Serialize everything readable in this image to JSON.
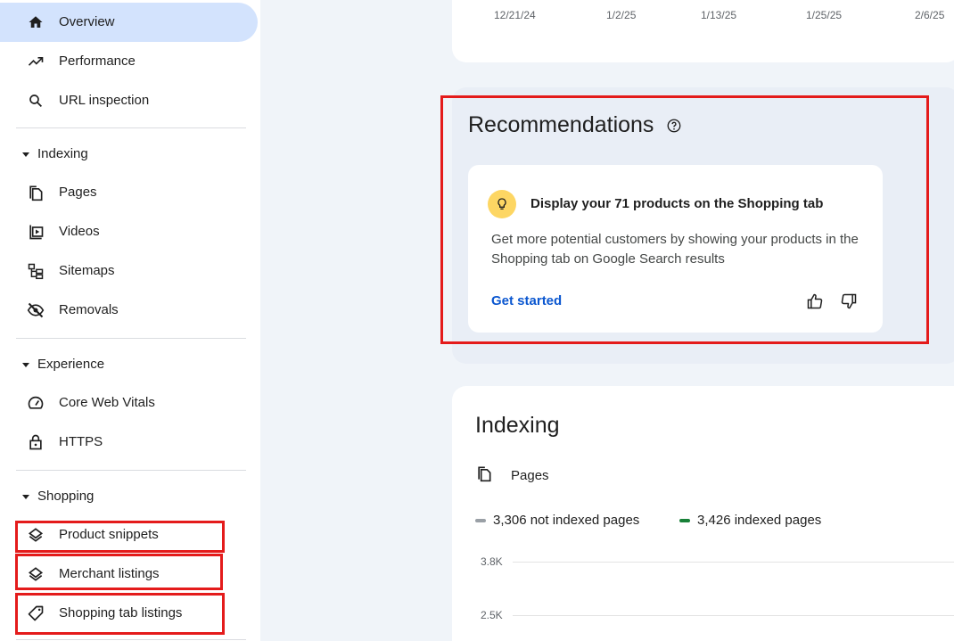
{
  "sidebar": {
    "overview": "Overview",
    "performance": "Performance",
    "url_inspection": "URL inspection",
    "indexing_section": "Indexing",
    "pages": "Pages",
    "videos": "Videos",
    "sitemaps": "Sitemaps",
    "removals": "Removals",
    "experience_section": "Experience",
    "core_web_vitals": "Core Web Vitals",
    "https": "HTTPS",
    "shopping_section": "Shopping",
    "product_snippets": "Product snippets",
    "merchant_listings": "Merchant listings",
    "shopping_tab_listings": "Shopping tab listings"
  },
  "top_chart": {
    "x_ticks": [
      "12/21/24",
      "1/2/25",
      "1/13/25",
      "1/25/25",
      "2/6/25"
    ]
  },
  "recommendations": {
    "title": "Recommendations",
    "card_title": "Display your 71 products on the Shopping tab",
    "card_body": "Get more potential customers by showing your products in the Shopping tab on Google Search results",
    "action": "Get started"
  },
  "indexing": {
    "title": "Indexing",
    "subtitle": "Pages",
    "legend_not_indexed": "3,306 not indexed pages",
    "legend_indexed": "3,426 indexed pages",
    "y_ticks": [
      "3.8K",
      "2.5K"
    ]
  },
  "colors": {
    "accent_blue": "#0b57d0",
    "active_nav_bg": "#d3e3fd",
    "highlight_red": "#e41b1b",
    "not_indexed_gray": "#9aa0a6",
    "indexed_green": "#188038",
    "bulb_yellow": "#fdd663"
  }
}
